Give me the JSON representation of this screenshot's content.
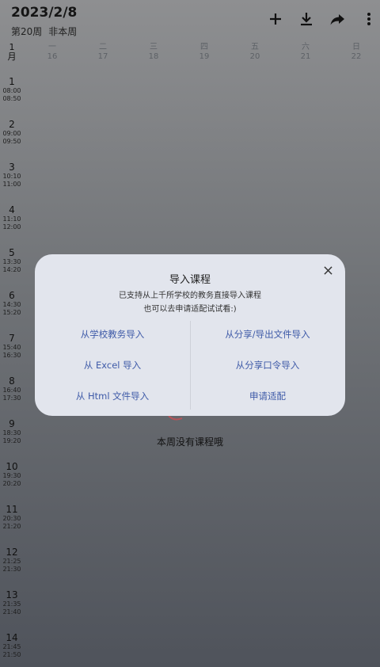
{
  "header": {
    "date": "2023/2/8",
    "week_no": "第20周",
    "week_status": "非本周"
  },
  "toolbar": {
    "icons": [
      "plus-icon",
      "download-icon",
      "share-icon",
      "more-vert-icon"
    ]
  },
  "calendar": {
    "month_num": "1",
    "month_char": "月",
    "days": [
      {
        "name": "一",
        "date": "16"
      },
      {
        "name": "二",
        "date": "17"
      },
      {
        "name": "三",
        "date": "18"
      },
      {
        "name": "四",
        "date": "19"
      },
      {
        "name": "五",
        "date": "20"
      },
      {
        "name": "六",
        "date": "21"
      },
      {
        "name": "日",
        "date": "22"
      }
    ],
    "slots": [
      {
        "n": "1",
        "start": "08:00",
        "end": "08:50"
      },
      {
        "n": "2",
        "start": "09:00",
        "end": "09:50"
      },
      {
        "n": "3",
        "start": "10:10",
        "end": "11:00"
      },
      {
        "n": "4",
        "start": "11:10",
        "end": "12:00"
      },
      {
        "n": "5",
        "start": "13:30",
        "end": "14:20"
      },
      {
        "n": "6",
        "start": "14:30",
        "end": "15:20"
      },
      {
        "n": "7",
        "start": "15:40",
        "end": "16:30"
      },
      {
        "n": "8",
        "start": "16:40",
        "end": "17:30"
      },
      {
        "n": "9",
        "start": "18:30",
        "end": "19:20"
      },
      {
        "n": "10",
        "start": "19:30",
        "end": "20:20"
      },
      {
        "n": "11",
        "start": "20:30",
        "end": "21:20"
      },
      {
        "n": "12",
        "start": "21:25",
        "end": "21:30"
      },
      {
        "n": "13",
        "start": "21:35",
        "end": "21:40"
      },
      {
        "n": "14",
        "start": "21:45",
        "end": "21:50"
      }
    ],
    "empty_message": "本周没有课程哦"
  },
  "dialog": {
    "title": "导入课程",
    "subtitle1": "已支持从上千所学校的教务直接导入课程",
    "subtitle2": "也可以去申请适配试试看:)",
    "left_options": [
      "从学校教务导入",
      "从 Excel 导入",
      "从 Html 文件导入"
    ],
    "right_options": [
      "从分享/导出文件导入",
      "从分享口令导入",
      "申请适配"
    ]
  }
}
